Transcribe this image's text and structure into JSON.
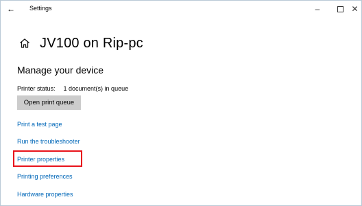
{
  "window": {
    "app_title": "Settings",
    "back_glyph": "←",
    "minimize_glyph": "–",
    "close_glyph": "✕"
  },
  "header": {
    "page_title": "JV100 on Rip-pc",
    "icon": "home-icon"
  },
  "main": {
    "section_title": "Manage your device",
    "status_label": "Printer status:",
    "status_value": "1 document(s) in queue",
    "open_queue_button": "Open print queue",
    "links": [
      "Print a test page",
      "Run the troubleshooter",
      "Printer properties",
      "Printing preferences",
      "Hardware properties"
    ]
  },
  "colors": {
    "link": "#0067b8",
    "highlight": "#e8131b",
    "button_bg": "#cccccc",
    "border": "#b9c9d6"
  }
}
